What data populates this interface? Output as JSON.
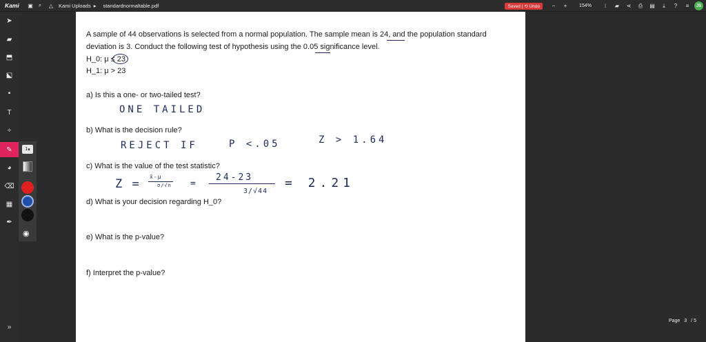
{
  "app": {
    "brand": "Kami"
  },
  "breadcrumb": {
    "folder": "Kami Uploads",
    "file": "standardnormaltable.pdf"
  },
  "toolbar": {
    "saved_label": "Saved | ⟲ Undo",
    "zoom": "154%",
    "avatar_initials": "JS"
  },
  "pen": {
    "size": "1"
  },
  "colors": {
    "swatch_red": "#e02020",
    "swatch_blue": "#1f4fa8",
    "swatch_black": "#111111",
    "accent": "#e0245e"
  },
  "document": {
    "intro_line1": "A sample of 44 observations is selected from a normal population. The sample mean is 24, and the population standard",
    "intro_line2": "deviation is 3. Conduct the following test of hypothesis using the 0.05 significance level.",
    "h0": "H_0: μ ≤ 23",
    "h1": "H_1: μ > 23",
    "qa": "a) Is this a one- or two-tailed test?",
    "qb": "b) What is the decision rule?",
    "qc": "c) What is the value of the test statistic?",
    "qd": "d) What is your decision regarding H_0?",
    "qe": "e) What is the p-value?",
    "qf": "f) Interpret the p-value?"
  },
  "handwriting": {
    "answer_a": "ONE TAILED",
    "answer_b_rule": "REJECT IF",
    "answer_b_p": "P <.05",
    "answer_b_z": "Z > 1.64",
    "answer_c_z": "Z =",
    "answer_c_frac1_top": "x̄-μ",
    "answer_c_frac1_bot": "σ/√n",
    "answer_c_eq": "=",
    "answer_c_frac2_top": "24-23",
    "answer_c_frac2_bot": "3/√44",
    "answer_c_result": "= 2.21"
  },
  "pagination": {
    "label": "Page",
    "current": "3",
    "total": "/ 5"
  }
}
